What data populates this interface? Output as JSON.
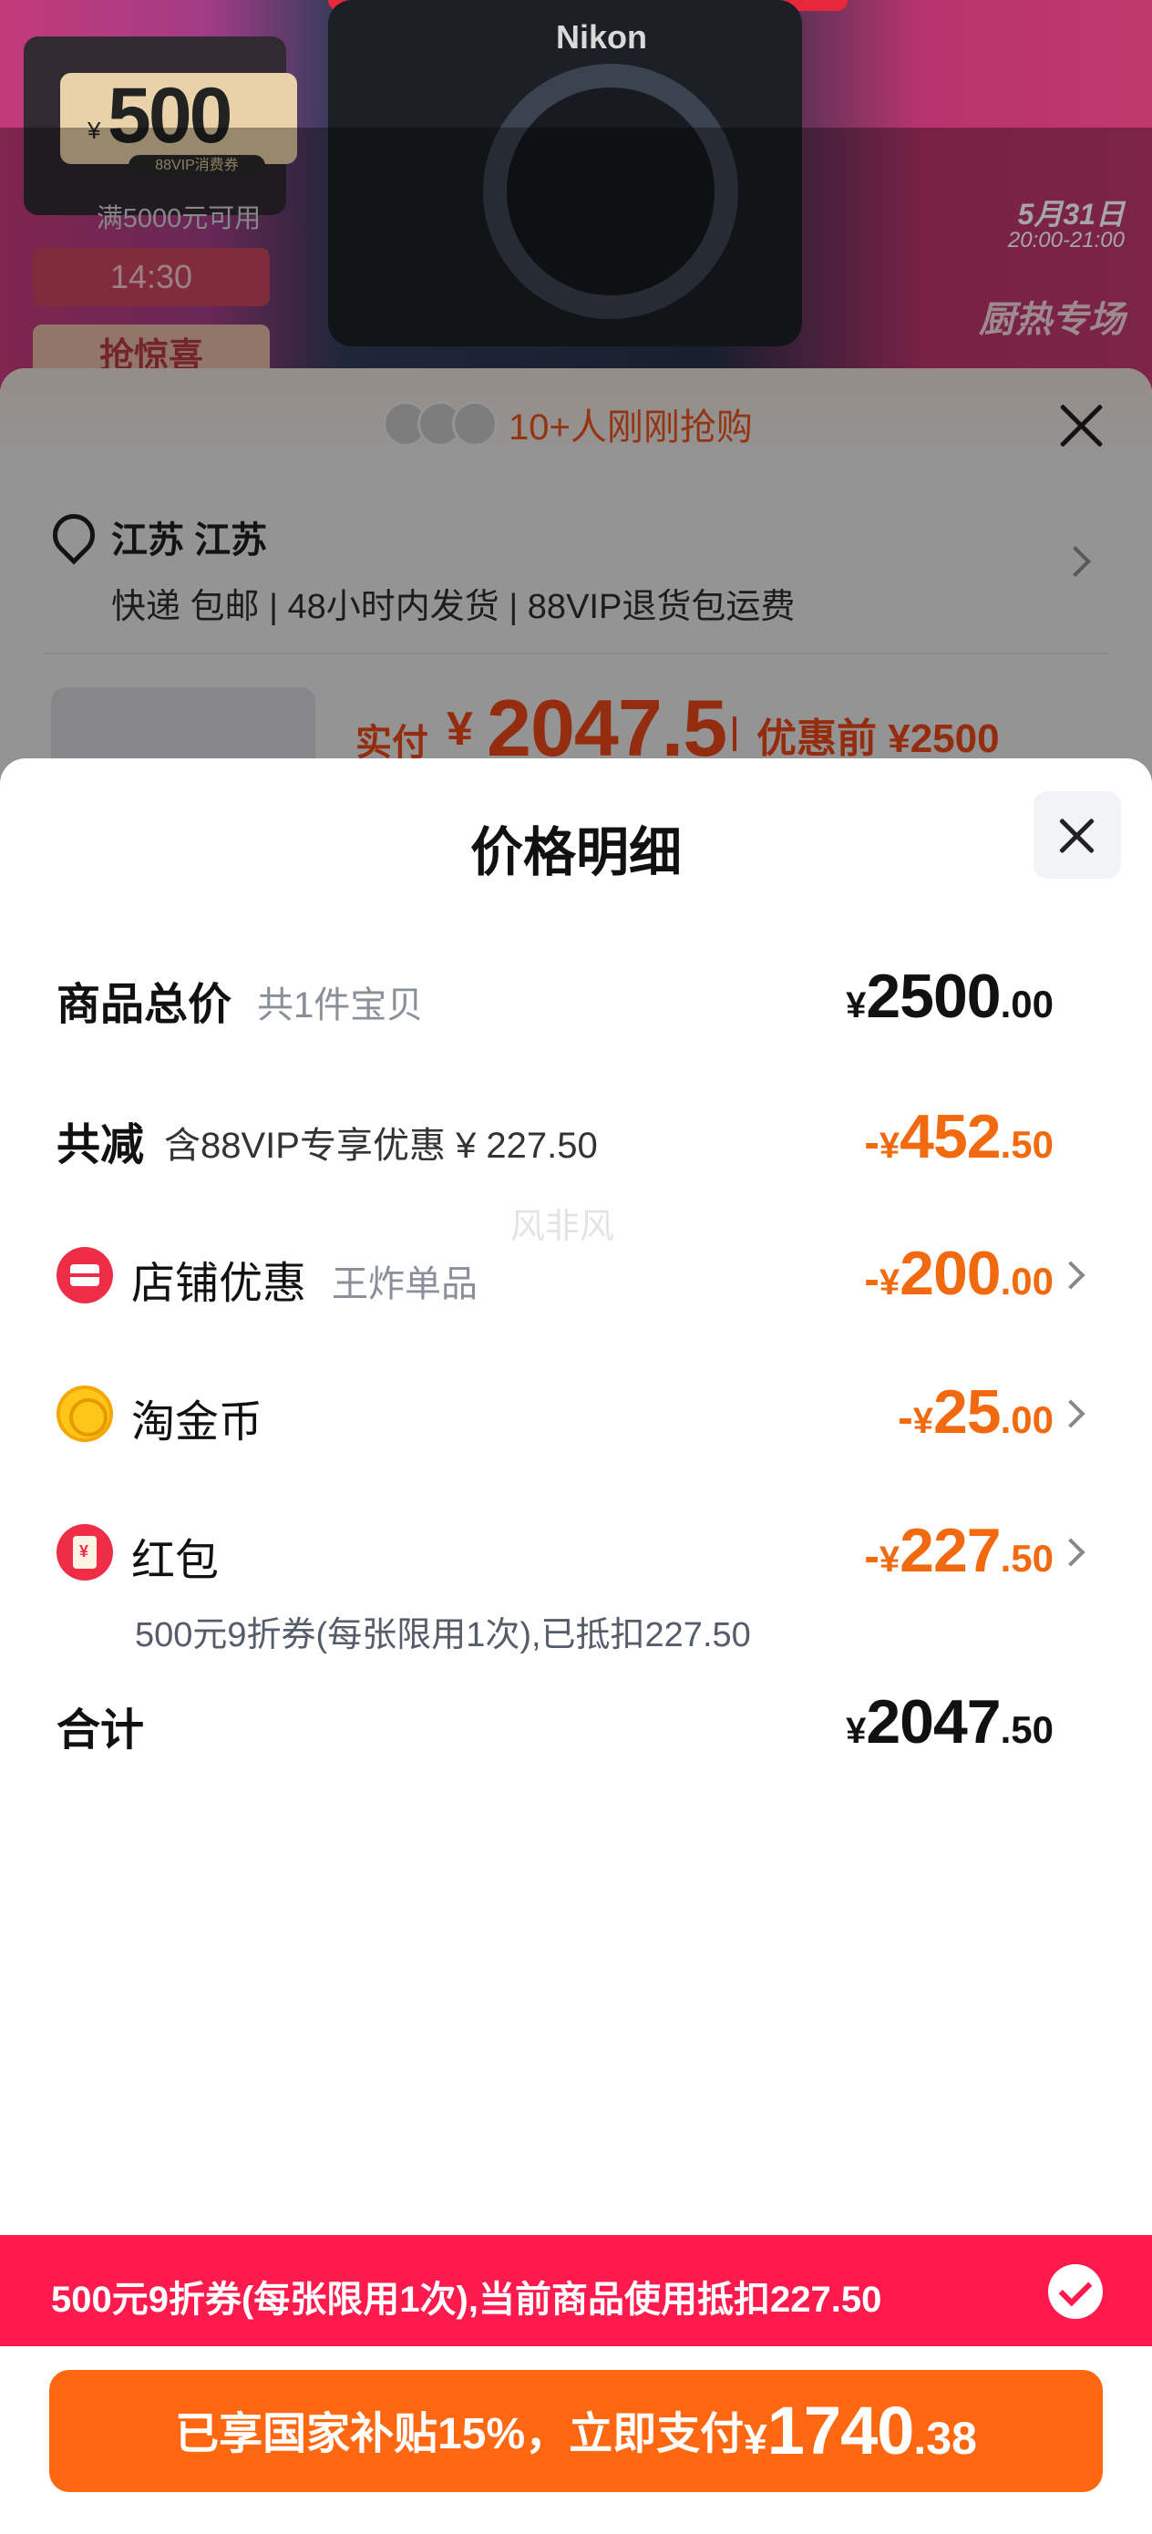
{
  "banner": {
    "coupon_yen": "¥",
    "coupon_amount": "500",
    "coupon_tag": "88VIP消费券",
    "coupon_condition": "满5000元可用",
    "time": "14:30",
    "grab": "抢惊喜",
    "brand": "Nikon",
    "date": "5月31日",
    "date_time": "20:00-21:00",
    "hot": "厨热专场"
  },
  "order": {
    "buyers": "10+人刚刚抢购",
    "address_title": "江苏 江苏",
    "address_sub": "快递 包邮 | 48小时内发货 | 88VIP退货包运费",
    "pay_label": "实付",
    "pay_yen": "¥",
    "pay_amount": "2047.5",
    "pay_before": "优惠前 ¥2500"
  },
  "price_detail": {
    "title": "价格明细",
    "total": {
      "label": "商品总价",
      "note": "共1件宝贝",
      "yen": "¥",
      "int": "2500",
      "dec": ".00"
    },
    "reduce": {
      "label": "共减",
      "note": "含88VIP专享优惠 ¥ 227.50",
      "sign": "-",
      "yen": "¥",
      "int": "452",
      "dec": ".50"
    },
    "shop": {
      "label": "店铺优惠",
      "note": "王炸单品",
      "icon": "shop-icon",
      "sign": "-",
      "yen": "¥",
      "int": "200",
      "dec": ".00"
    },
    "coin": {
      "label": "淘金币",
      "icon": "coin-icon",
      "sign": "-",
      "yen": "¥",
      "int": "25",
      "dec": ".00"
    },
    "redpacket": {
      "label": "红包",
      "icon": "red-packet-icon",
      "sub": "500元9折券(每张限用1次),已抵扣227.50",
      "sign": "-",
      "yen": "¥",
      "int": "227",
      "dec": ".50"
    },
    "sum": {
      "label": "合计",
      "yen": "¥",
      "int": "2047",
      "dec": ".50"
    },
    "watermark": "风非风"
  },
  "coupon_bar": {
    "text": "500元9折券(每张限用1次),当前商品使用抵扣227.50",
    "checked": true
  },
  "pay_button": {
    "text": "已享国家补贴15%，立即支付",
    "yen": "¥",
    "int": "1740",
    "dec": ".38"
  },
  "colors": {
    "accent_orange": "#ff6810",
    "coupon_red": "#ff1a4d",
    "discount_orange": "#f26a10"
  }
}
